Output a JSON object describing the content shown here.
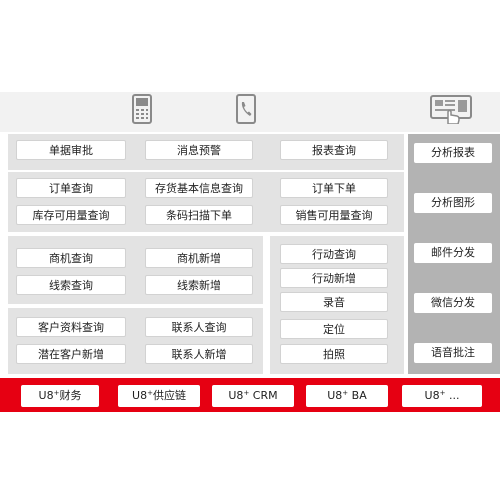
{
  "icons": [
    "phone-icon",
    "call-icon",
    "tablet-touch-icon"
  ],
  "colors": {
    "accent": "#e60012",
    "panel": "#e3e3e3",
    "right_panel": "#b3b3b3"
  },
  "rows": {
    "row1": [
      "单据审批",
      "消息预警",
      "报表查询"
    ],
    "row2": [
      "订单查询",
      "存货基本信息查询",
      "订单下单"
    ],
    "row3": [
      "库存可用量查询",
      "条码扫描下单",
      "销售可用量查询"
    ],
    "crm_left": [
      "商机查询",
      "商机新增",
      "线索查询",
      "线索新增"
    ],
    "crm_right": [
      "行动查询",
      "行动新增",
      "录音",
      "定位",
      "拍照"
    ],
    "customer": [
      "客户资料查询",
      "联系人查询",
      "潜在客户新增",
      "联系人新增"
    ]
  },
  "right_items": [
    "分析报表",
    "分析图形",
    "邮件分发",
    "微信分发",
    "语音批注"
  ],
  "bottom": [
    {
      "prefix": "U8",
      "sup": "+",
      "suffix": "财务"
    },
    {
      "prefix": "U8",
      "sup": "+",
      "suffix": "供应链"
    },
    {
      "prefix": "U8",
      "sup": "+",
      "suffix": " CRM"
    },
    {
      "prefix": "U8",
      "sup": "+",
      "suffix": " BA"
    },
    {
      "prefix": "U8",
      "sup": "+",
      "suffix": " ..."
    }
  ]
}
